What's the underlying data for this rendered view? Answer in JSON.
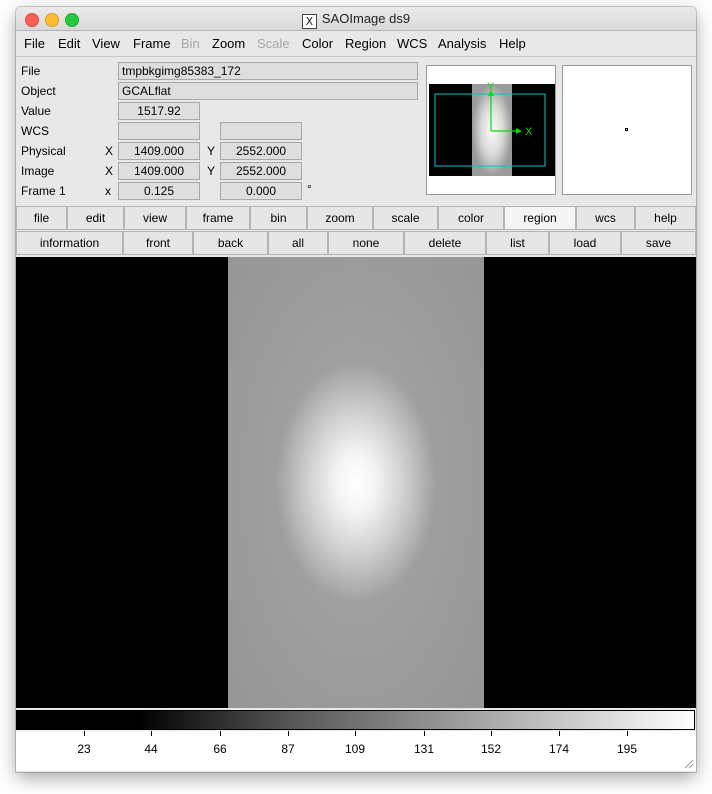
{
  "window": {
    "title": "SAOImage ds9"
  },
  "menubar": [
    "File",
    "Edit",
    "View",
    "Frame",
    "Bin",
    "Zoom",
    "Scale",
    "Color",
    "Region",
    "WCS",
    "Analysis",
    "Help"
  ],
  "menubar_disabled": [
    "Bin",
    "Scale"
  ],
  "info": {
    "file_label": "File",
    "file_value": "tmpbkgimg85383_172",
    "object_label": "Object",
    "object_value": "GCALflat",
    "value_label": "Value",
    "value_value": "1517.92",
    "wcs_label": "WCS",
    "physical_label": "Physical",
    "physical_x_label": "X",
    "physical_x": "1409.000",
    "physical_y_label": "Y",
    "physical_y": "2552.000",
    "image_label": "Image",
    "image_x_label": "X",
    "image_x": "1409.000",
    "image_y_label": "Y",
    "image_y": "2552.000",
    "frame_label": "Frame 1",
    "frame_x_label": "x",
    "frame_zoom": "0.125",
    "frame_angle": "0.000",
    "degree_symbol": "°"
  },
  "panner": {
    "x_label": "X",
    "y_label": "Y"
  },
  "buttons_main": [
    "file",
    "edit",
    "view",
    "frame",
    "bin",
    "zoom",
    "scale",
    "color",
    "region",
    "wcs",
    "help"
  ],
  "buttons_main_active": "region",
  "buttons_region": [
    "information",
    "front",
    "back",
    "all",
    "none",
    "delete",
    "list",
    "load",
    "save"
  ],
  "colorbar": {
    "tick_labels": [
      "23",
      "44",
      "66",
      "87",
      "109",
      "131",
      "152",
      "174",
      "195"
    ]
  },
  "colors": {
    "background": "#e8e8e8",
    "panner_box": "#00c8c8",
    "panner_axes": "#00e000"
  }
}
